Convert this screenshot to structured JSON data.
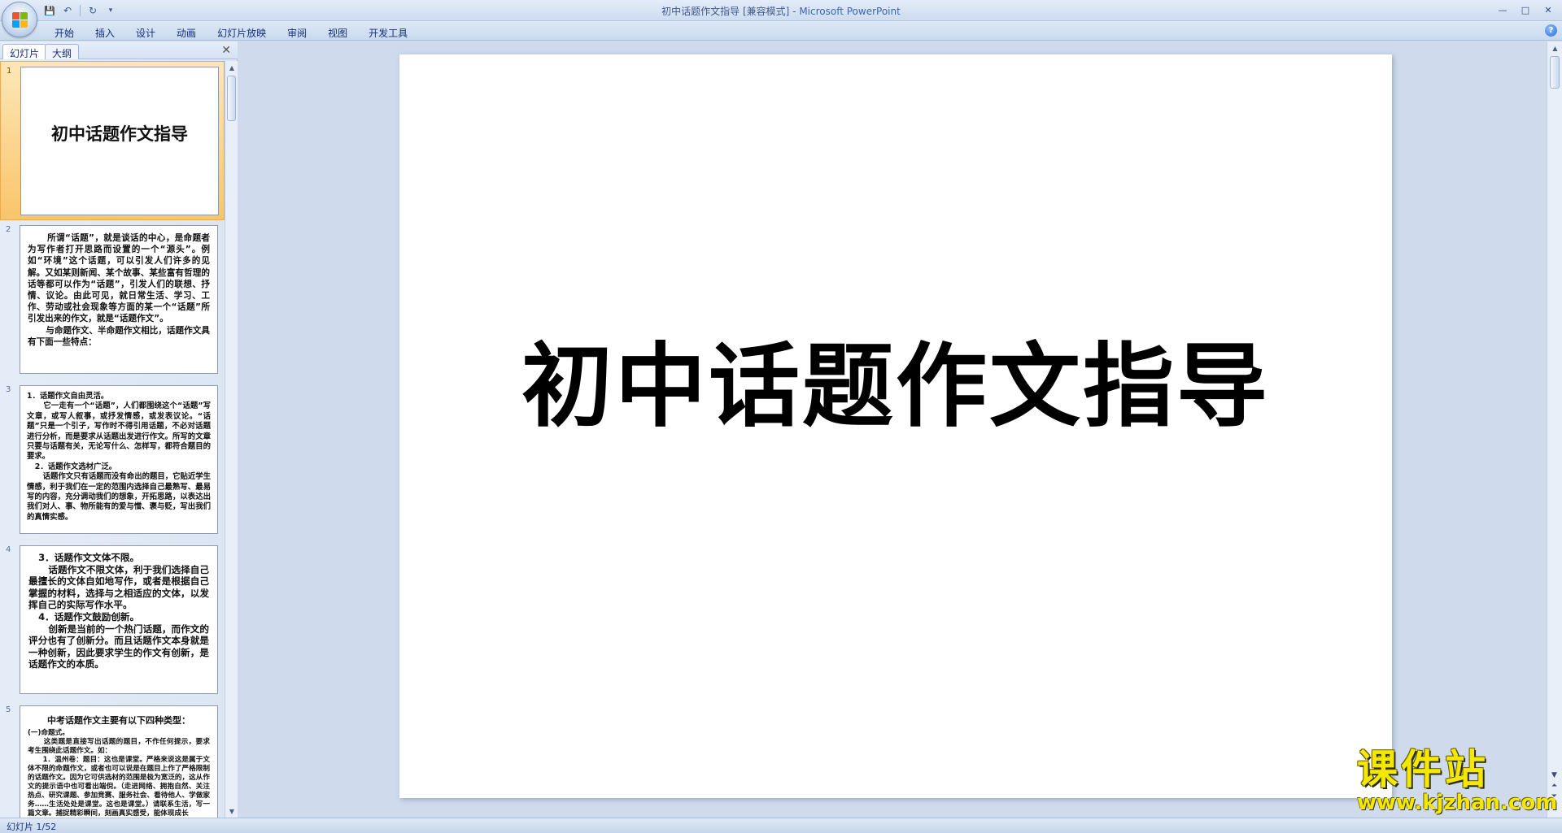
{
  "window": {
    "title": "初中话题作文指导 [兼容模式]",
    "separator": " - ",
    "app_name": "Microsoft PowerPoint",
    "controls": {
      "minimize": "—",
      "maximize": "□",
      "close": "✕"
    }
  },
  "qat": {
    "save_icon": "💾",
    "undo_icon": "↶",
    "redo_icon": "↻",
    "dropdown_icon": "▾"
  },
  "ribbon": {
    "tabs": [
      "开始",
      "插入",
      "设计",
      "动画",
      "幻灯片放映",
      "审阅",
      "视图",
      "开发工具"
    ],
    "help": "?"
  },
  "left_pane": {
    "tabs": {
      "slides": "幻灯片",
      "outline": "大纲"
    },
    "close": "✕",
    "thumbnails": [
      {
        "num": "1",
        "title": "初中话题作文指导"
      },
      {
        "num": "2",
        "text": "      所谓“话题”，就是谈话的中心，是命题者为写作者打开思路而设置的一个“源头”。例如“环境”这个话题，可以引发人们许多的见解。又如某则新闻、某个故事、某些富有哲理的话等都可以作为“话题”，引发人们的联想、抒情、议论。由此可见，就日常生活、学习、工作、劳动或社会现象等方面的某一个“话题”所引发出来的作文，就是“话题作文”。\n      与命题作文、半命题作文相比，话题作文具有下面一些特点："
      },
      {
        "num": "3",
        "text": "1．话题作文自由灵活。\n      它一走有一个“话题”，人们都围绕这个“话题”写文章，或写人叙事，或抒发情感，或发表议论。“话题”只是一个引子，写作时不得引用话题，不必对话题进行分析，而是要求从话题出发进行作文。所写的文章只要与话题有关，无论写什么、怎样写，都符合题目的要求。\n   2．话题作文选材广泛。\n      话题作文只有话题而没有命出的题目，它贴近学生情感，利于我们在一定的范围内选择自己最熟写、最易写的内容，充分调动我们的想象，开拓思路，以表达出我们对人、事、物所能有的爱与憎、褒与贬，写出我们的真情实感。"
      },
      {
        "num": "4",
        "text": "   3．话题作文文体不限。\n      话题作文不限文体，利于我们选择自己最擅长的文体自如地写作，或者是根据自己掌握的材料，选择与之相适应的文体，以发挥自己的实际写作水平。\n   4．话题作文鼓励创新。\n      创新是当前的一个热门话题，而作文的评分也有了创新分。而且话题作文本身就是一种创新，因此要求学生的作文有创新，是话题作文的本质。"
      },
      {
        "num": "5",
        "heading": "中考话题作文主要有以下四种类型：",
        "text": "(一)命题式。\n      这类题是直接写出话题的题目，不作任何提示，要求考生围绕此话题作文。如：\n      1．温州卷：题目：这也是课堂。严格来说这是属于文体不限的命题作文，或者也可以说是在题目上作了严格限制的话题作文。因为它可供选材的范围是极为宽泛的，这从作文的提示语中也可看出端倪。（走进网络、拥抱自然、关注热点、研究课题、参加竞赛、服务社会、看待他人、学做家务……生活处处是课堂。这也是课堂。）请联系生活，写一篇文章。捕捉精彩瞬间，刻画真实感受，能体现成长"
      }
    ]
  },
  "slide": {
    "title": "初中话题作文指导"
  },
  "status": {
    "slide_info": "幻灯片 1/52"
  },
  "watermark": {
    "cn": "课件站",
    "url": "www.kjzhan.com"
  },
  "colors": {
    "chrome_blue": "#cfdbec",
    "text_blue": "#15317a",
    "selected_thumb": "#f9c56a",
    "watermark_yellow": "#f5e800"
  }
}
